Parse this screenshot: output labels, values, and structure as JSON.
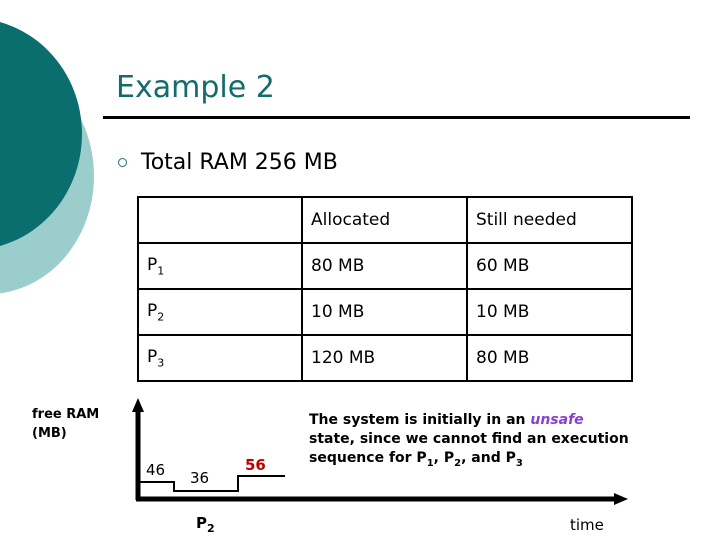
{
  "slide": {
    "title": "Example 2",
    "bullet": {
      "marker": "circle-outline-bullet",
      "text": "Total RAM 256 MB"
    }
  },
  "table": {
    "headers": [
      "",
      "Allocated",
      "Still needed"
    ],
    "rows": [
      {
        "process": "P",
        "process_sub": "1",
        "allocated": "80 MB",
        "still_needed": "60 MB"
      },
      {
        "process": "P",
        "process_sub": "2",
        "allocated": "10 MB",
        "still_needed": "10 MB"
      },
      {
        "process": "P",
        "process_sub": "3",
        "allocated": "120 MB",
        "still_needed": "80 MB"
      }
    ]
  },
  "note": {
    "part1": "The system is initially in an ",
    "emphasis": "unsafe",
    "part2": "state, since we cannot find an execution sequence for P",
    "sub1": "1",
    "comma1": ", P",
    "sub2": "2",
    "comma2": ", and P",
    "sub3": "3"
  },
  "colors": {
    "title": "#136b6b",
    "deco_dark": "#0a6e6e",
    "deco_light": "#9ccdcd",
    "unsafe": "#8b3fd0",
    "highlight_value": "#c00000",
    "axis": "#000000"
  },
  "chart_data": {
    "type": "line",
    "title": "",
    "xlabel": "time",
    "ylabel": "free RAM\n(MB)",
    "ylabel_line1": "free RAM",
    "ylabel_line2": "(MB)",
    "grid": false,
    "legend": false,
    "x": [
      0,
      1,
      2,
      3
    ],
    "step_levels": [
      46,
      36,
      56
    ],
    "point_labels": [
      "46",
      "36",
      "56"
    ],
    "highlighted_label": "56",
    "segment_labels": [
      "P",
      "2"
    ],
    "segment_label_text": "P2",
    "xlim": [
      0,
      3.6
    ],
    "ylim": [
      0,
      120
    ],
    "annotations": [
      {
        "text": "46",
        "value": 46,
        "color": "#000000"
      },
      {
        "text": "36",
        "value": 36,
        "color": "#000000"
      },
      {
        "text": "56",
        "value": 56,
        "color": "#c00000"
      }
    ]
  }
}
